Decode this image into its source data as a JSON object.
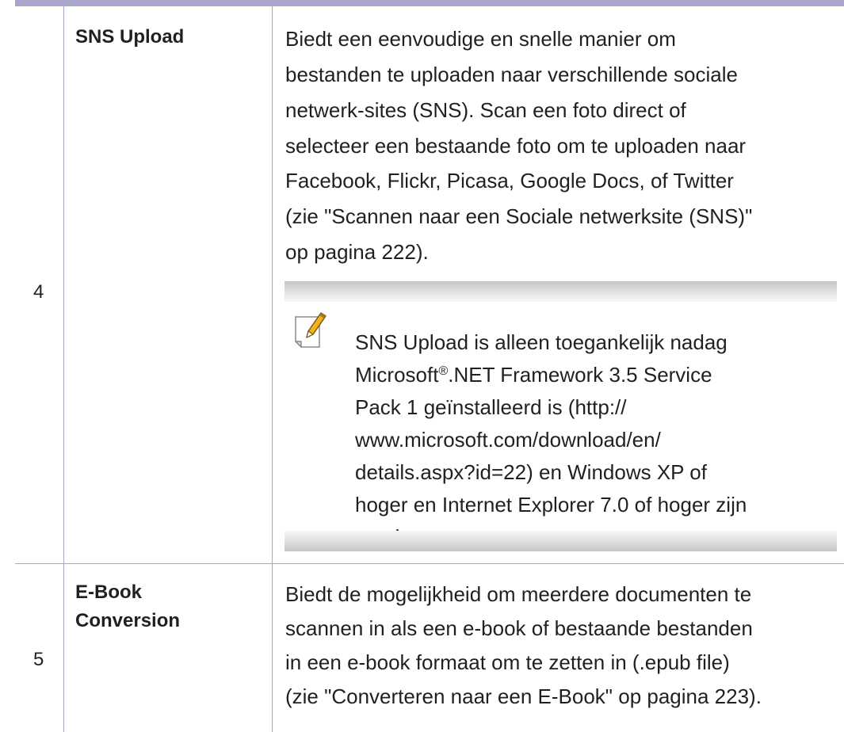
{
  "rows": [
    {
      "number": "4",
      "feature": "SNS Upload",
      "description_lines": [
        "Biedt een eenvoudige en snelle manier om",
        "bestanden te uploaden naar verschillende sociale",
        "netwerk-sites (SNS). Scan een foto direct of",
        "selecteer een bestaande foto om te uploaden naar",
        "Facebook, Flickr, Picasa, Google Docs, of Twitter",
        "(zie \"Scannen naar een Sociale netwerksite (SNS)\"",
        "op pagina 222)."
      ],
      "note": {
        "icon": "note-pencil-icon",
        "line1": "SNS Upload is alleen toegankelijk nadag",
        "line2_prefix": "Microsoft",
        "line2_sup": "®",
        "line2_suffix": ".NET Framework 3.5 Service",
        "lines_rest": [
          "Pack 1 geïnstalleerd is (http://",
          "www.microsoft.com/download/en/",
          "details.aspx?id=22) en Windows XP of",
          "hoger en Internet Explorer 7.0 of hoger zijn",
          "vereist."
        ]
      }
    },
    {
      "number": "5",
      "feature_lines": [
        "E-Book",
        "Conversion"
      ],
      "description_lines": [
        "Biedt de mogelijkheid om meerdere documenten te",
        "scannen in als een e-book of bestaande bestanden",
        "in een e-book formaat om te zetten in (.epub file)",
        "(zie \"Converteren naar een E-Book\" op pagina 223)."
      ]
    }
  ],
  "colors": {
    "rule": "#a8a6cc",
    "text": "#231f20",
    "note_bar": "#c5c5c5",
    "icon_pencil": "#f2b21b"
  }
}
